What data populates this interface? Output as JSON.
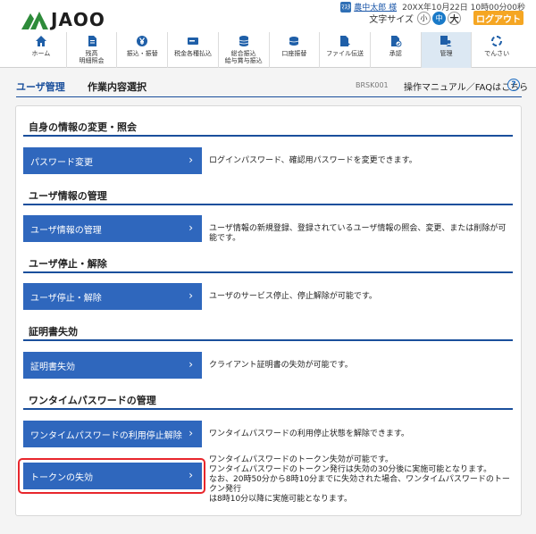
{
  "header": {
    "logo_text": "JAOO",
    "user_icon": "ﾏｽﾀ",
    "user_name": "農中太郎 様",
    "timestamp": "20XX年10月22日 10時00分00秒",
    "text_size_label": "文字サイズ",
    "text_size_small": "小",
    "text_size_medium": "中",
    "text_size_large": "大",
    "logout_label": "ログアウト"
  },
  "nav": [
    {
      "label": "ホーム",
      "icon": "home-icon"
    },
    {
      "label": "残高\n明細照会",
      "icon": "document-icon"
    },
    {
      "label": "振込・振替",
      "icon": "yen-coin-icon"
    },
    {
      "label": "税金各種払込",
      "icon": "payment-card-icon"
    },
    {
      "label": "総合振込\n給与賞与振込",
      "icon": "coins-stack-icon"
    },
    {
      "label": "口座振替",
      "icon": "coins-icon"
    },
    {
      "label": "ファイル伝送",
      "icon": "file-transfer-icon"
    },
    {
      "label": "承認",
      "icon": "approval-icon"
    },
    {
      "label": "管理",
      "icon": "manage-icon"
    },
    {
      "label": "でんさい",
      "icon": "densai-icon"
    }
  ],
  "page": {
    "title": "ユーザ管理",
    "subtitle": "作業内容選択",
    "screen_id": "BRSK001",
    "manual_link": "操作マニュアル／FAQはこちら",
    "help_icon": "?"
  },
  "sections": [
    {
      "heading": "自身の情報の変更・照会",
      "actions": [
        {
          "label": "パスワード変更",
          "desc": "ログインパスワード、確認用パスワードを変更できます。"
        }
      ]
    },
    {
      "heading": "ユーザ情報の管理",
      "actions": [
        {
          "label": "ユーザ情報の管理",
          "desc": "ユーザ情報の新規登録、登録されているユーザ情報の照会、変更、または削除が可能です。"
        }
      ]
    },
    {
      "heading": "ユーザ停止・解除",
      "actions": [
        {
          "label": "ユーザ停止・解除",
          "desc": "ユーザのサービス停止、停止解除が可能です。"
        }
      ]
    },
    {
      "heading": "証明書失効",
      "actions": [
        {
          "label": "証明書失効",
          "desc": "クライアント証明書の失効が可能です。"
        }
      ]
    },
    {
      "heading": "ワンタイムパスワードの管理",
      "actions": [
        {
          "label": "ワンタイムパスワードの利用停止解除",
          "desc": "ワンタイムパスワードの利用停止状態を解除できます。"
        },
        {
          "label": "トークンの失効",
          "desc_lines": [
            "ワンタイムパスワードのトークン失効が可能です。",
            "ワンタイムパスワードのトークン発行は失効の30分後に実施可能となります。",
            "なお、20時50分から8時10分までに失効された場合、ワンタイムパスワードのトークン発行",
            "は8時10分以降に実施可能となります。"
          ]
        }
      ]
    }
  ],
  "chevron": "›",
  "colors": {
    "primary_blue": "#2f67bd",
    "heading_rule": "#1a4f9c",
    "logout_orange": "#f5a623",
    "highlight_red": "#e8262c"
  }
}
